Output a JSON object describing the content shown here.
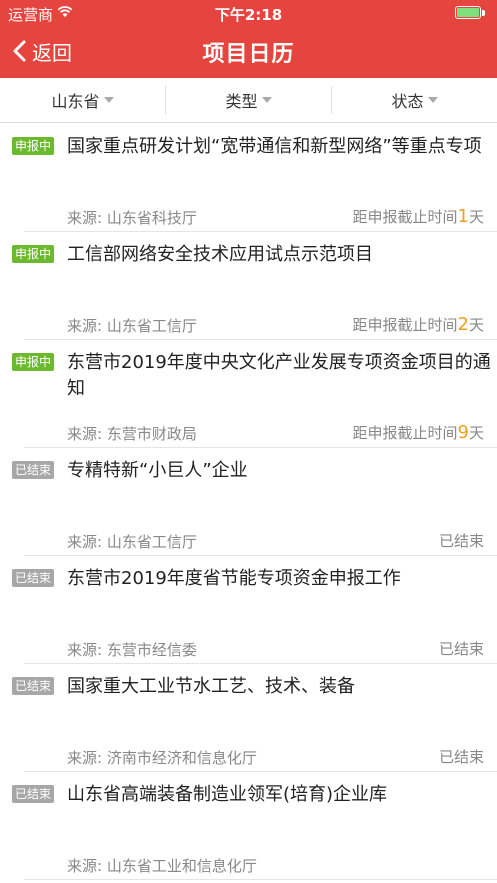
{
  "status_bar": {
    "carrier": "运营商",
    "time": "下午2:18"
  },
  "nav": {
    "back_label": "返回",
    "title": "项目日历"
  },
  "filters": [
    {
      "label": "山东省"
    },
    {
      "label": "类型"
    },
    {
      "label": "状态"
    }
  ],
  "items": [
    {
      "badge": "申报中",
      "state": "active",
      "title": "国家重点研发计划“宽带通信和新型网络”等重点专项",
      "source": "来源: 山东省科技厅",
      "status_prefix": "距申报截止时间",
      "days": "1",
      "status_suffix": "天"
    },
    {
      "badge": "申报中",
      "state": "active",
      "title": "工信部网络安全技术应用试点示范项目",
      "source": "来源: 山东省工信厅",
      "status_prefix": "距申报截止时间",
      "days": "2",
      "status_suffix": "天"
    },
    {
      "badge": "申报中",
      "state": "active",
      "title": "东营市2019年度中央文化产业发展专项资金项目的通知",
      "source": "来源: 东营市财政局",
      "status_prefix": "距申报截止时间",
      "days": "9",
      "status_suffix": "天"
    },
    {
      "badge": "已结束",
      "state": "ended",
      "title": "专精特新“小巨人”企业",
      "source": "来源: 山东省工信厅",
      "status_prefix": "已结束",
      "days": "",
      "status_suffix": ""
    },
    {
      "badge": "已结束",
      "state": "ended",
      "title": "东营市2019年度省节能专项资金申报工作",
      "source": "来源: 东营市经信委",
      "status_prefix": "已结束",
      "days": "",
      "status_suffix": ""
    },
    {
      "badge": "已结束",
      "state": "ended",
      "title": "国家重大工业节水工艺、技术、装备",
      "source": "来源: 济南市经济和信息化厅",
      "status_prefix": "已结束",
      "days": "",
      "status_suffix": ""
    },
    {
      "badge": "已结束",
      "state": "ended",
      "title": "山东省高端装备制造业领军(培育)企业库",
      "source": "来源: 山东省工业和信息化厅",
      "status_prefix": "",
      "days": "",
      "status_suffix": ""
    }
  ]
}
